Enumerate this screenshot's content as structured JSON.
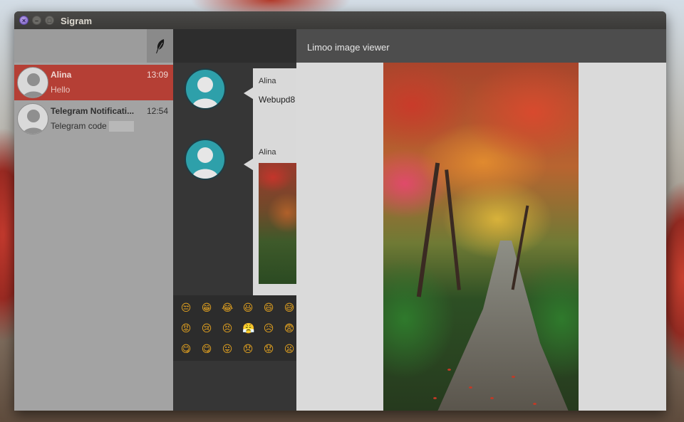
{
  "window": {
    "title": "Sigram",
    "controls": {
      "close": "×",
      "minimize": "–",
      "maximize": "□"
    }
  },
  "sidebar": {
    "compose_icon": "feather-icon",
    "chats": [
      {
        "name": "Alina",
        "time": "13:09",
        "message": "Hello",
        "active": true
      },
      {
        "name": "Telegram Notificati...",
        "time": "12:54",
        "message": "Telegram code",
        "active": false
      }
    ]
  },
  "conversation": {
    "messages": [
      {
        "sender": "Alina",
        "text": "Webupd8"
      },
      {
        "sender": "Alina",
        "text": ""
      }
    ],
    "emojis": [
      "😒",
      "😁",
      "😂",
      "😃",
      "😄",
      "😅",
      "😡",
      "😢",
      "😣",
      "😤",
      "😥",
      "😨",
      "😋",
      "😋",
      "😛",
      "😞",
      "😟",
      "😦"
    ]
  },
  "viewer": {
    "title": "Limoo image viewer"
  },
  "colors": {
    "active_chat": "#b53f35",
    "avatar_teal": "#2ea0aa",
    "sidebar_bg": "#a3a3a3",
    "viewer_header": "#4d4d4d"
  }
}
